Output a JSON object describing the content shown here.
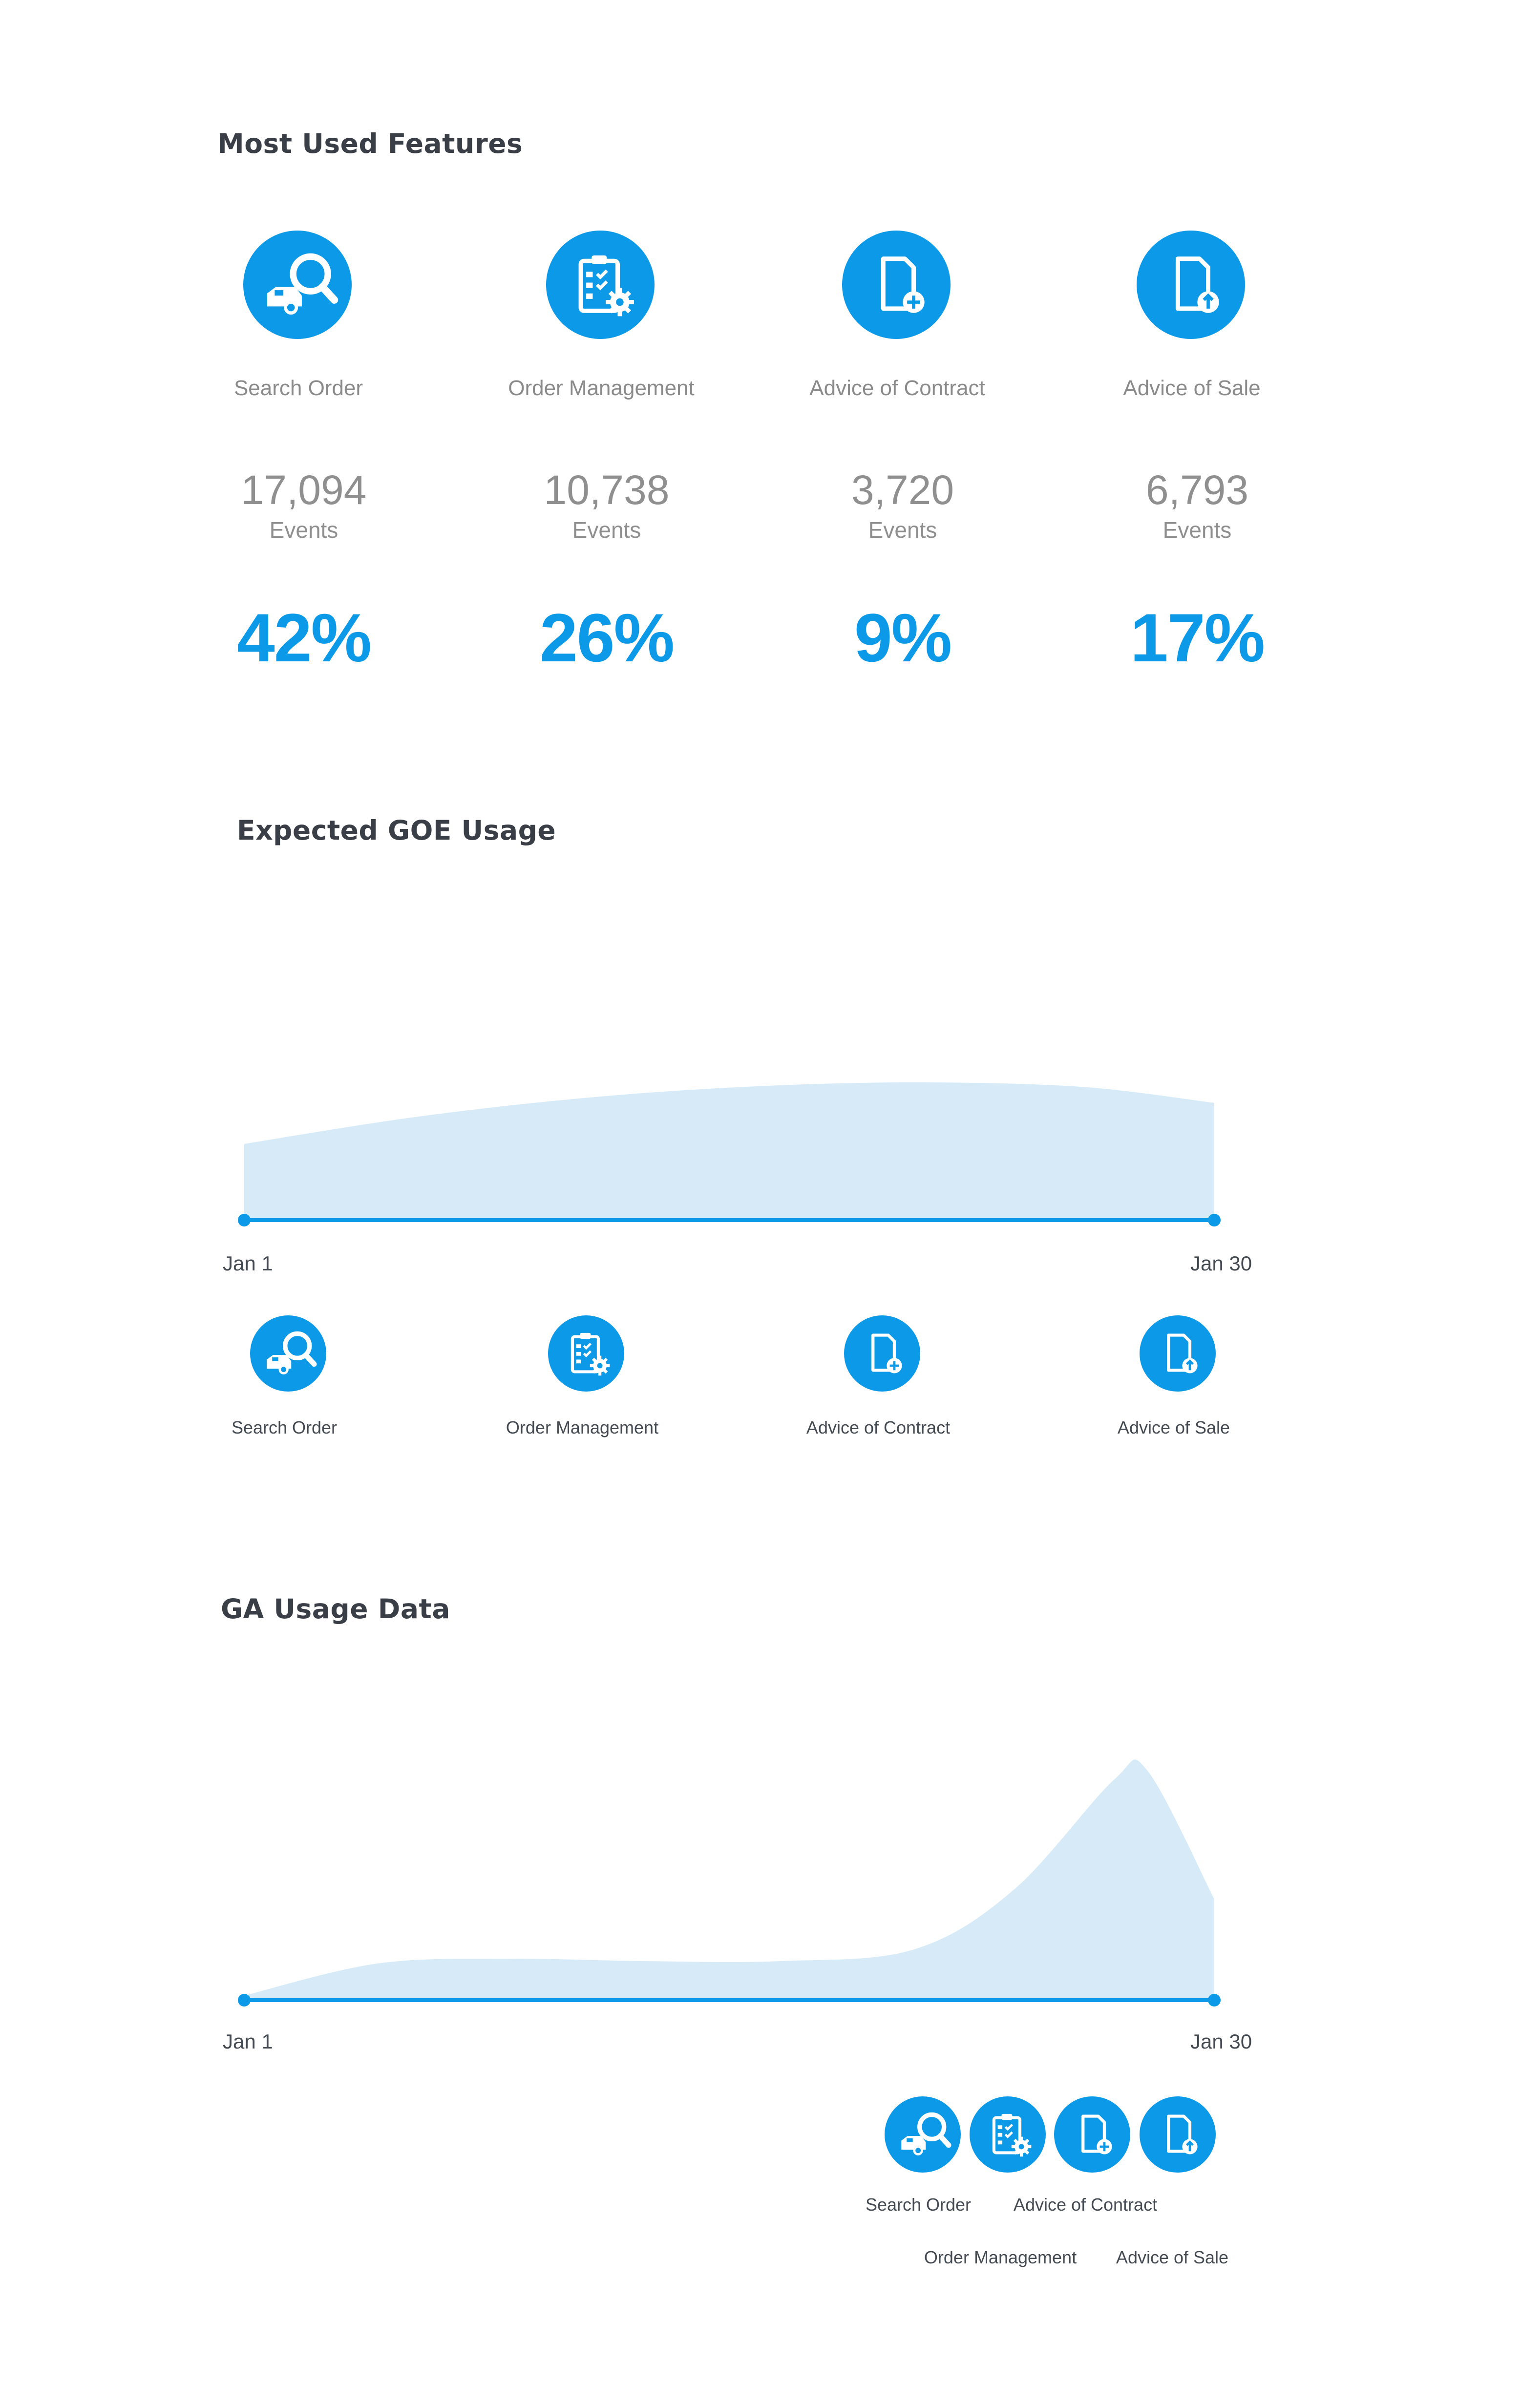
{
  "sections": {
    "most_used": {
      "title": "Most Used Features",
      "features": [
        {
          "name": "Search Order",
          "icon": "car-search-icon",
          "events_count": "17,094",
          "events_label": "Events",
          "percent": "42%"
        },
        {
          "name": "Order Management",
          "icon": "clipboard-gear-icon",
          "events_count": "10,738",
          "events_label": "Events",
          "percent": "26%"
        },
        {
          "name": "Advice of Contract",
          "icon": "document-plus-icon",
          "events_count": "3,720",
          "events_label": "Events",
          "percent": "9%"
        },
        {
          "name": "Advice of Sale",
          "icon": "document-upload-icon",
          "events_count": "6,793",
          "events_label": "Events",
          "percent": "17%"
        }
      ]
    },
    "goe": {
      "title": "Expected GOE Usage",
      "x_start": "Jan 1",
      "x_end": "Jan 30",
      "legend": [
        "Search Order",
        "Order Management",
        "Advice of Contract",
        "Advice of Sale"
      ]
    },
    "ga": {
      "title": "GA Usage Data",
      "x_start": "Jan 1",
      "x_end": "Jan 30",
      "legend": [
        "Search Order",
        "Advice of Contract",
        "Order Management",
        "Advice of Sale"
      ]
    }
  },
  "colors": {
    "accent": "#0c9ae8",
    "area_fill": "#d6eaf8",
    "heading": "#3a3f47",
    "muted_text": "#8a8a8a"
  },
  "chart_data": [
    {
      "type": "area",
      "title": "Expected GOE Usage",
      "x": [
        1,
        6,
        11,
        16,
        21,
        26,
        30
      ],
      "x_tick_labels": [
        "Jan 1",
        "Jan 30"
      ],
      "values": [
        0.52,
        0.7,
        0.83,
        0.91,
        0.94,
        0.91,
        0.8
      ],
      "ylim": [
        0,
        1
      ],
      "grid": false,
      "legend_placement": "bottom"
    },
    {
      "type": "area",
      "title": "GA Usage Data",
      "x": [
        1,
        5,
        9,
        13,
        17,
        21,
        24,
        27,
        28,
        30
      ],
      "x_tick_labels": [
        "Jan 1",
        "Jan 30"
      ],
      "values": [
        0.02,
        0.16,
        0.18,
        0.17,
        0.17,
        0.22,
        0.48,
        0.96,
        1.0,
        0.44
      ],
      "ylim": [
        0,
        1
      ],
      "grid": false,
      "legend_placement": "bottom-right"
    }
  ]
}
